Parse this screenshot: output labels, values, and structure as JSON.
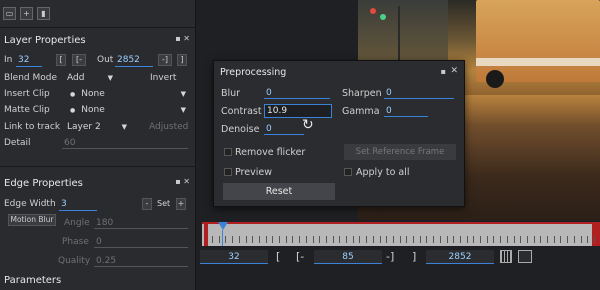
{
  "layer_properties": {
    "title": "Layer Properties",
    "in_label": "In",
    "in_value": "32",
    "bracket_open": "[",
    "bracket_dash_open": "[-",
    "out_label": "Out",
    "out_value": "2852",
    "bracket_dash_close": "-]",
    "bracket_close": "]",
    "blend_mode_label": "Blend Mode",
    "blend_mode_value": "Add",
    "invert_label": "Invert",
    "insert_clip_label": "Insert Clip",
    "insert_clip_value": "None",
    "matte_clip_label": "Matte Clip",
    "matte_clip_value": "None",
    "link_label": "Link to track",
    "link_value": "Layer 2",
    "adjusted_label": "Adjusted",
    "detail_label": "Detail",
    "detail_value": "60"
  },
  "edge_properties": {
    "title": "Edge Properties",
    "width_label": "Edge Width",
    "width_value": "3",
    "minus_label": "-",
    "set_label": "Set",
    "plus_label": "+",
    "motion_blur_label": "Motion Blur",
    "angle_label": "Angle",
    "angle_value": "180",
    "phase_label": "Phase",
    "phase_value": "0",
    "quality_label": "Quality",
    "quality_value": "0.25"
  },
  "parameters_title": "Parameters",
  "preprocessing": {
    "title": "Preprocessing",
    "blur_label": "Blur",
    "blur_value": "0",
    "sharpen_label": "Sharpen",
    "sharpen_value": "0",
    "contrast_label": "Contrast",
    "contrast_value": "10.9",
    "gamma_label": "Gamma",
    "gamma_value": "0",
    "denoise_label": "Denoise",
    "denoise_value": "0",
    "remove_flicker_label": "Remove flicker",
    "set_ref_label": "Set Reference Frame",
    "preview_label": "Preview",
    "apply_all_label": "Apply to all",
    "reset_label": "Reset"
  },
  "timeline_bar": {
    "in_value": "32",
    "bracket_open": "[",
    "bracket_dash_open": "[-",
    "current_value": "85",
    "bracket_dash_close": "-]",
    "bracket_close": "]",
    "out_value": "2852"
  },
  "icons": {
    "close": "✕",
    "pin": "▪"
  }
}
